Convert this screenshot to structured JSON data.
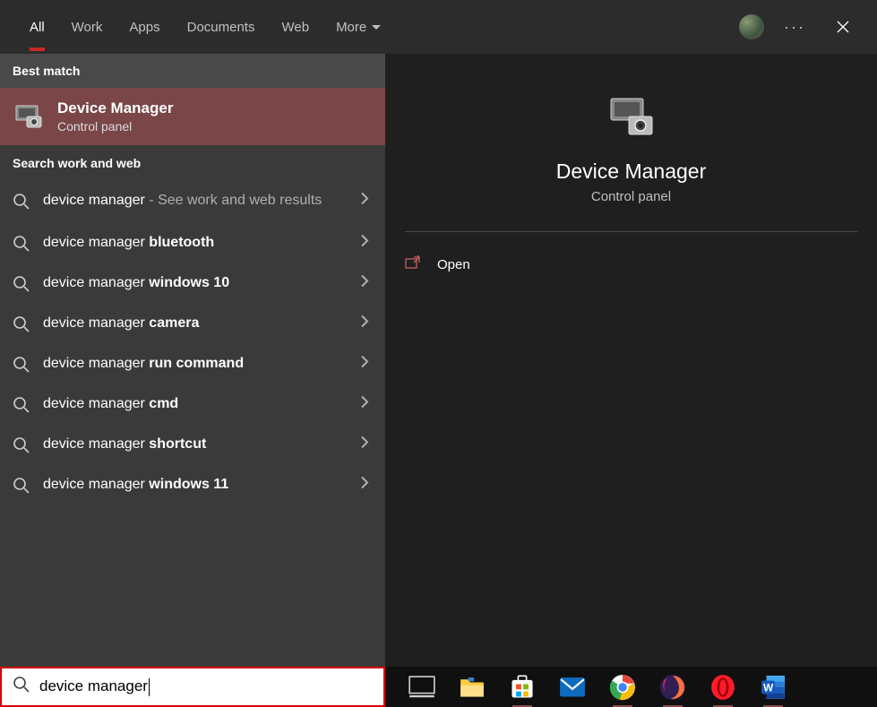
{
  "tabs": {
    "all": "All",
    "work": "Work",
    "apps": "Apps",
    "documents": "Documents",
    "web": "Web",
    "more": "More"
  },
  "section_headers": {
    "best_match": "Best match",
    "search_web": "Search work and web"
  },
  "best_match": {
    "title": "Device Manager",
    "subtitle": "Control panel"
  },
  "suggestions": [
    {
      "prefix": "device manager",
      "bold": "",
      "hint": " - See work and web results"
    },
    {
      "prefix": "device manager ",
      "bold": "bluetooth",
      "hint": ""
    },
    {
      "prefix": "device manager ",
      "bold": "windows 10",
      "hint": ""
    },
    {
      "prefix": "device manager ",
      "bold": "camera",
      "hint": ""
    },
    {
      "prefix": "device manager ",
      "bold": "run command",
      "hint": ""
    },
    {
      "prefix": "device manager ",
      "bold": "cmd",
      "hint": ""
    },
    {
      "prefix": "device manager ",
      "bold": "shortcut",
      "hint": ""
    },
    {
      "prefix": "device manager ",
      "bold": "windows 11",
      "hint": ""
    }
  ],
  "detail": {
    "title": "Device Manager",
    "subtitle": "Control panel",
    "actions": {
      "open": "Open"
    }
  },
  "search_box": {
    "value": "device manager"
  },
  "taskbar_apps": [
    "task-view",
    "file-explorer",
    "microsoft-store",
    "mail",
    "chrome",
    "firefox",
    "opera",
    "word"
  ]
}
